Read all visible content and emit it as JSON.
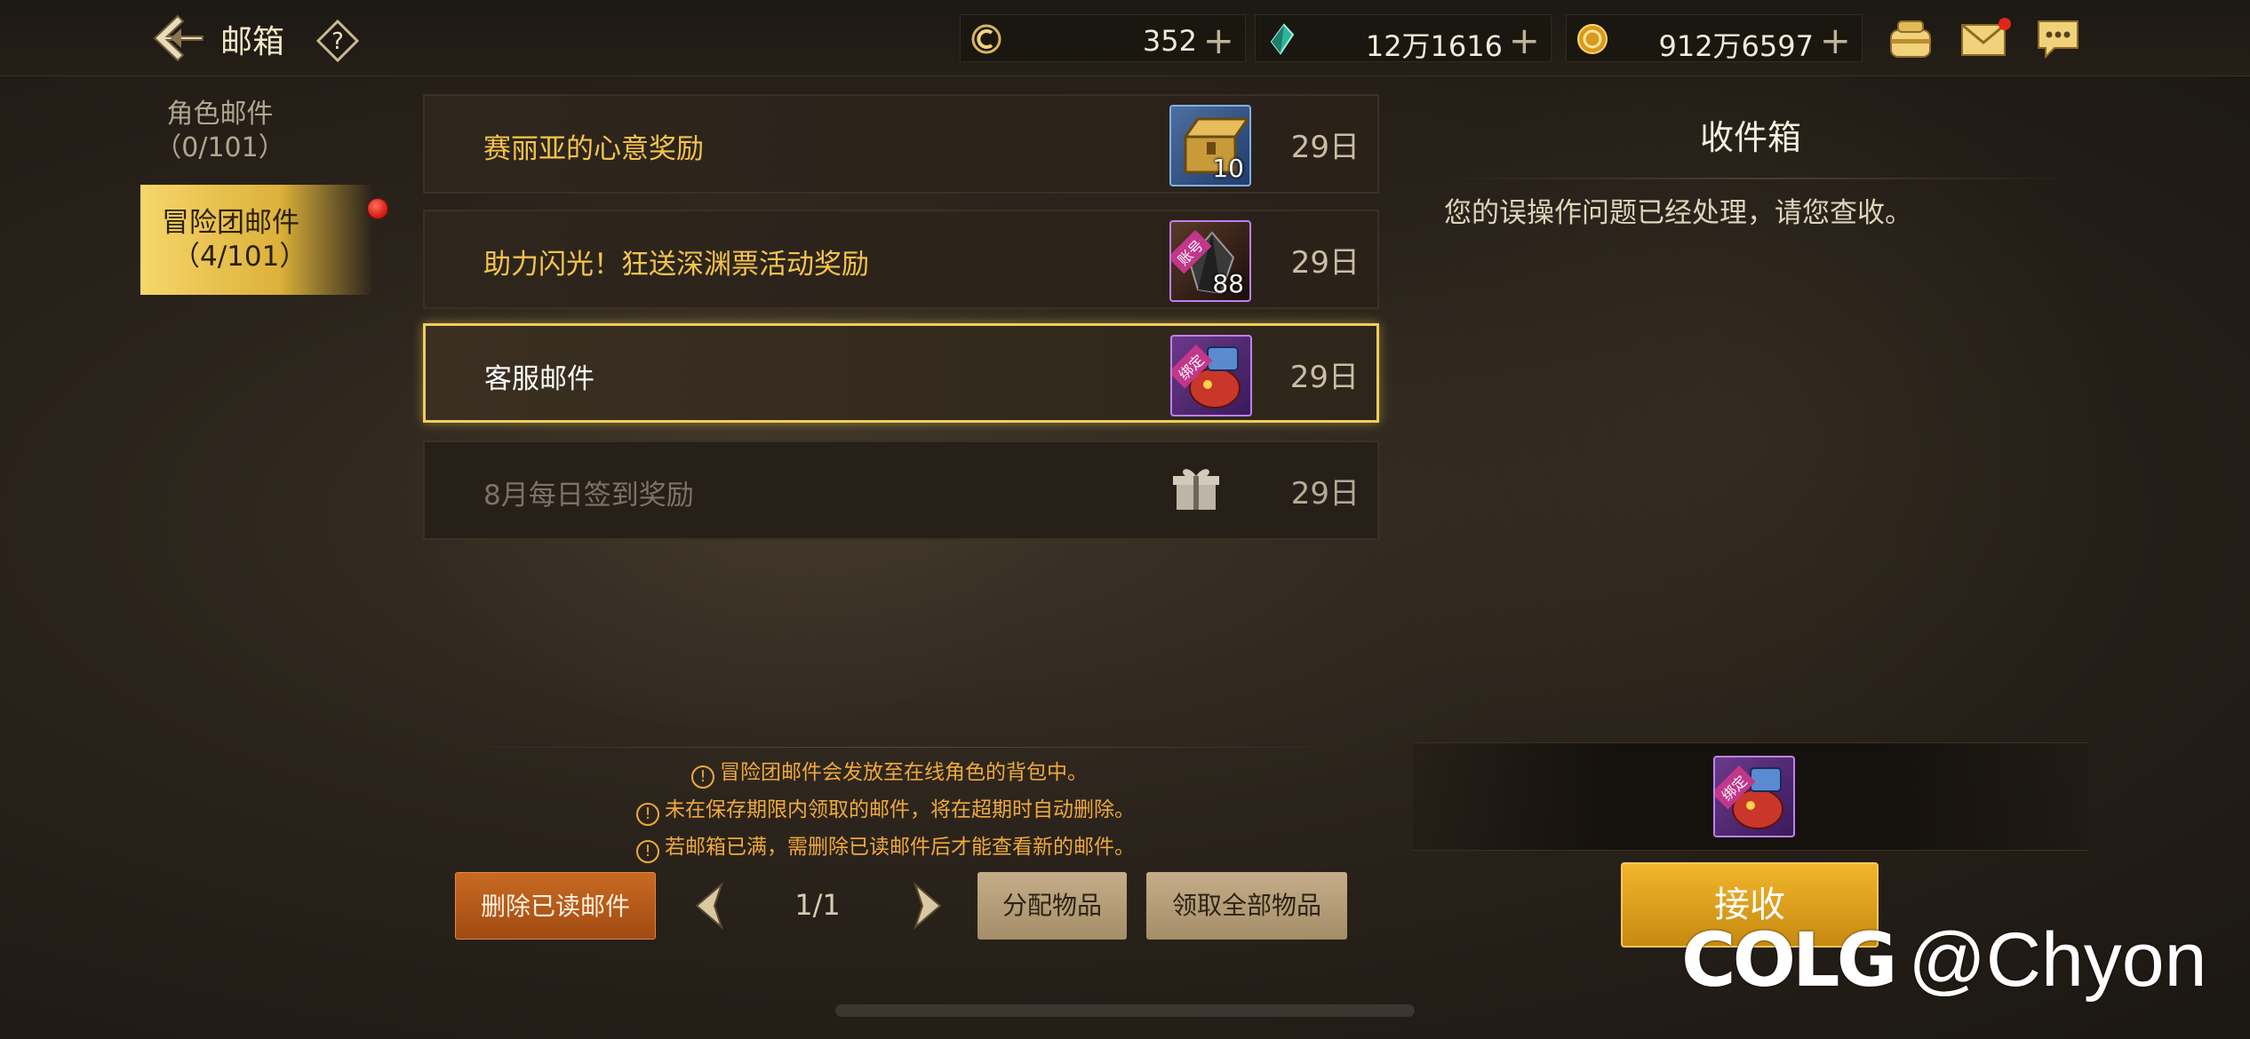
{
  "header": {
    "title": "邮箱",
    "help_label": "?",
    "resources": [
      {
        "icon": "coin-c-icon",
        "value": "352"
      },
      {
        "icon": "green-gem-icon",
        "value": "12万1616"
      },
      {
        "icon": "gold-coin-icon",
        "value": "912万6597"
      }
    ],
    "plus_label": "+"
  },
  "tabs": [
    {
      "label": "角色邮件",
      "count": "（0/101）"
    },
    {
      "label": "冒险团邮件",
      "count": "（4/101）",
      "selected": true,
      "has_alert": true
    }
  ],
  "mail_list": [
    {
      "subject": "赛丽亚的心意奖励",
      "item_qty": "10",
      "days": "29日",
      "state": "unread"
    },
    {
      "subject": "助力闪光！狂送深渊票活动奖励",
      "item_qty": "88",
      "item_tag": "账号",
      "days": "29日",
      "state": "unread"
    },
    {
      "subject": "客服邮件",
      "item_tag": "绑定",
      "days": "29日",
      "state": "selected"
    },
    {
      "subject": "8月每日签到奖励",
      "days": "29日",
      "state": "read"
    }
  ],
  "detail": {
    "panel_title": "收件箱",
    "body": "您的误操作问题已经处理，请您查收。",
    "attachment_tag": "绑定",
    "receive_label": "接收"
  },
  "notices": [
    "冒险团邮件会发放至在线角色的背包中。",
    "未在保存期限内领取的邮件，将在超期时自动删除。",
    "若邮箱已满，需删除已读邮件后才能查看新的邮件。"
  ],
  "notice_mark": "!",
  "footer": {
    "delete_read_label": "删除已读邮件",
    "page_label": "1/1",
    "distribute_label": "分配物品",
    "claim_all_label": "领取全部物品"
  },
  "watermark": {
    "logo": "COLG",
    "text": "@Chyon"
  },
  "colors": {
    "accent_gold": "#f6c44c",
    "alert_red": "#d81b12",
    "notice_orange": "#f0a93c",
    "receive_button": "#e5a420"
  }
}
